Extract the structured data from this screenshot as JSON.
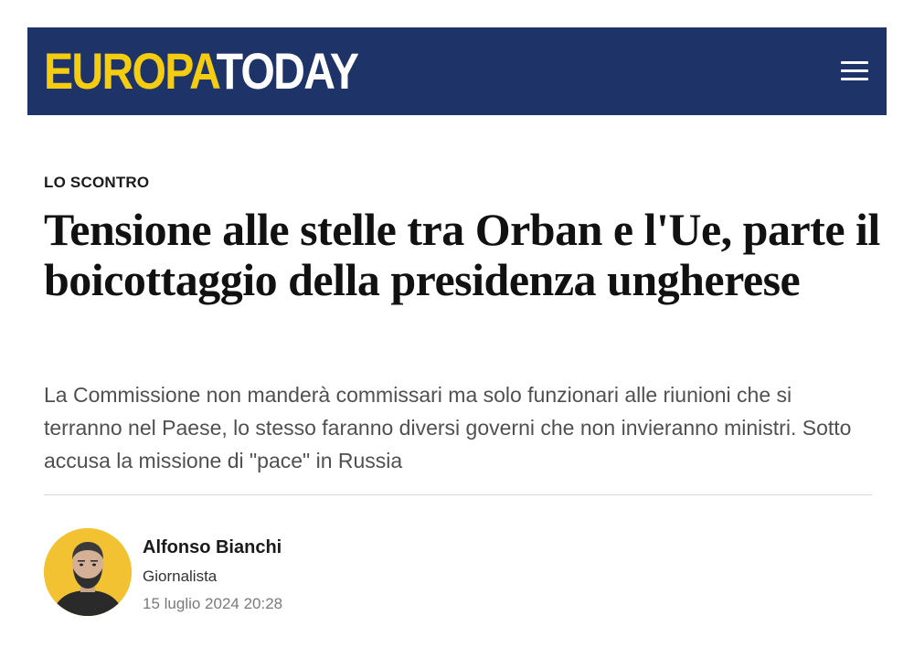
{
  "header": {
    "logo_part1": "EUROPA",
    "logo_part2": "TODAY",
    "menu_icon": "hamburger-menu-icon",
    "background_color": "#1e3469",
    "logo_accent_color": "#f5cc10"
  },
  "article": {
    "kicker": "LO SCONTRO",
    "headline": "Tensione alle stelle tra Orban e l'Ue, parte il boicottaggio della presidenza ungherese",
    "summary": "La Commissione non manderà commissari ma solo funzionari alle riunioni che si terranno nel Paese, lo stesso faranno diversi governi che non invieranno ministri. Sotto accusa la missione di \"pace\" in Russia"
  },
  "author": {
    "name": "Alfonso Bianchi",
    "role": "Giornalista",
    "date": "15 luglio 2024 20:28",
    "avatar_background": "#f2c233"
  }
}
